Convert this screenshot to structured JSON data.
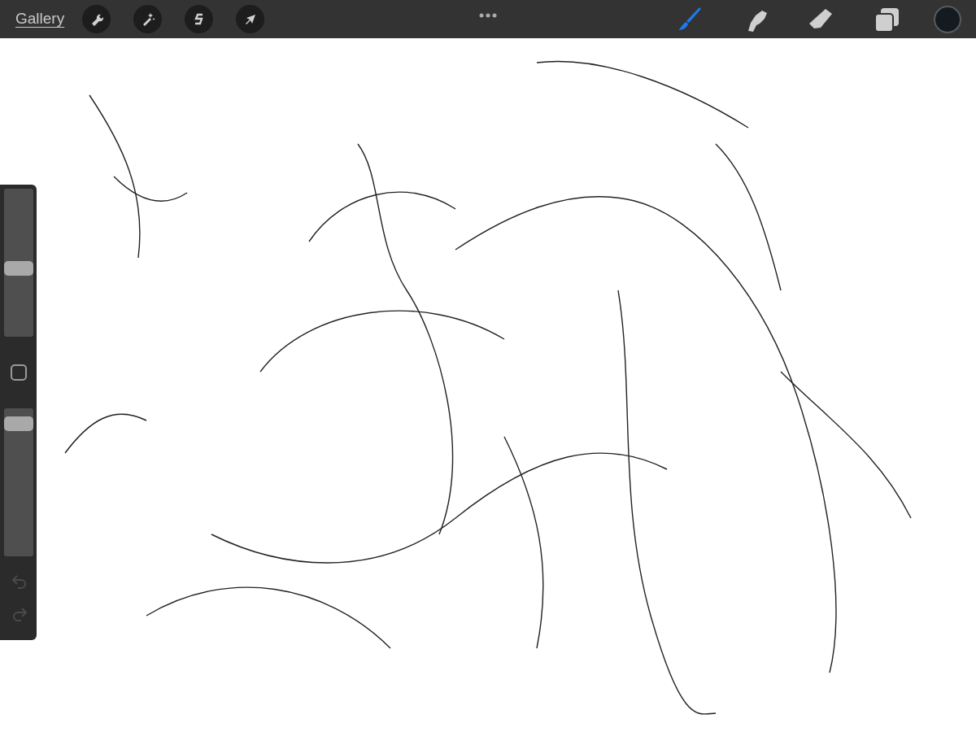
{
  "toolbar": {
    "gallery_label": "Gallery",
    "actions": [
      {
        "kind": "wrench"
      },
      {
        "kind": "wand"
      },
      {
        "kind": "selection"
      },
      {
        "kind": "transform"
      }
    ],
    "tools": [
      {
        "kind": "brush",
        "selected": true
      },
      {
        "kind": "smudge",
        "selected": false
      },
      {
        "kind": "eraser",
        "selected": false
      },
      {
        "kind": "layers",
        "selected": false
      }
    ],
    "current_color": {
      "color": "#131b21"
    }
  },
  "sidebar": {
    "brush_size": {
      "level": 0.46
    },
    "opacity": {
      "level": 0.94
    },
    "history": [
      {
        "kind": "undo",
        "disabled": true
      },
      {
        "kind": "redo",
        "disabled": true
      }
    ]
  }
}
